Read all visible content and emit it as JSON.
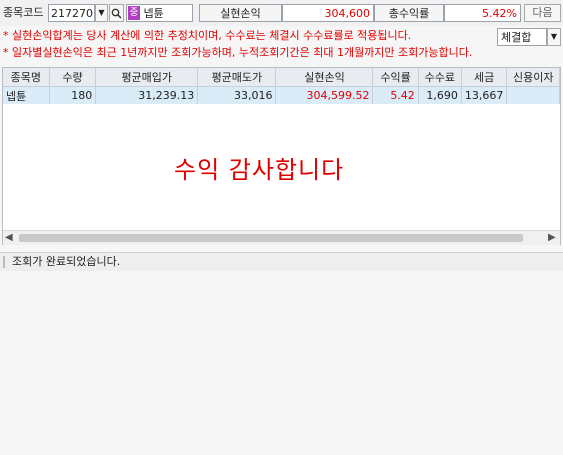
{
  "toolbar": {
    "code_label": "종목코드",
    "code_value": "217270",
    "stock_badge": "중",
    "stock_name": "넵튠",
    "realized_label": "실현손익",
    "realized_value": "304,600",
    "return_label": "총수익률",
    "return_value": "5.42%",
    "next_button": "다음"
  },
  "notes": {
    "line1": "* 실현손익합계는 당사 계산에 의한 추정치이며, 수수료는 체결시 수수료률로 적용됩니다.",
    "line2": "* 일자별실현손익은 최근 1년까지만 조회가능하며, 누적조회기간은 최대 1개월까지만 조회가능합니다.",
    "filter_value": "체결합"
  },
  "table": {
    "headers": [
      "종목명",
      "수량",
      "평균매입가",
      "평균매도가",
      "실현손익",
      "수익률",
      "수수료",
      "세금",
      "신용이자"
    ],
    "rows": [
      [
        "넵튠",
        "180",
        "31,239.13",
        "33,016",
        "304,599.52",
        "5.42",
        "1,690",
        "13,667",
        ""
      ]
    ]
  },
  "overlay_text": "수익 감사합니다",
  "status": {
    "message": "조회가 완료되었습니다."
  },
  "colors": {
    "profit_red": "#e00000",
    "row_selected": "#d9ecf8",
    "badge_purple": "#b040c0"
  }
}
